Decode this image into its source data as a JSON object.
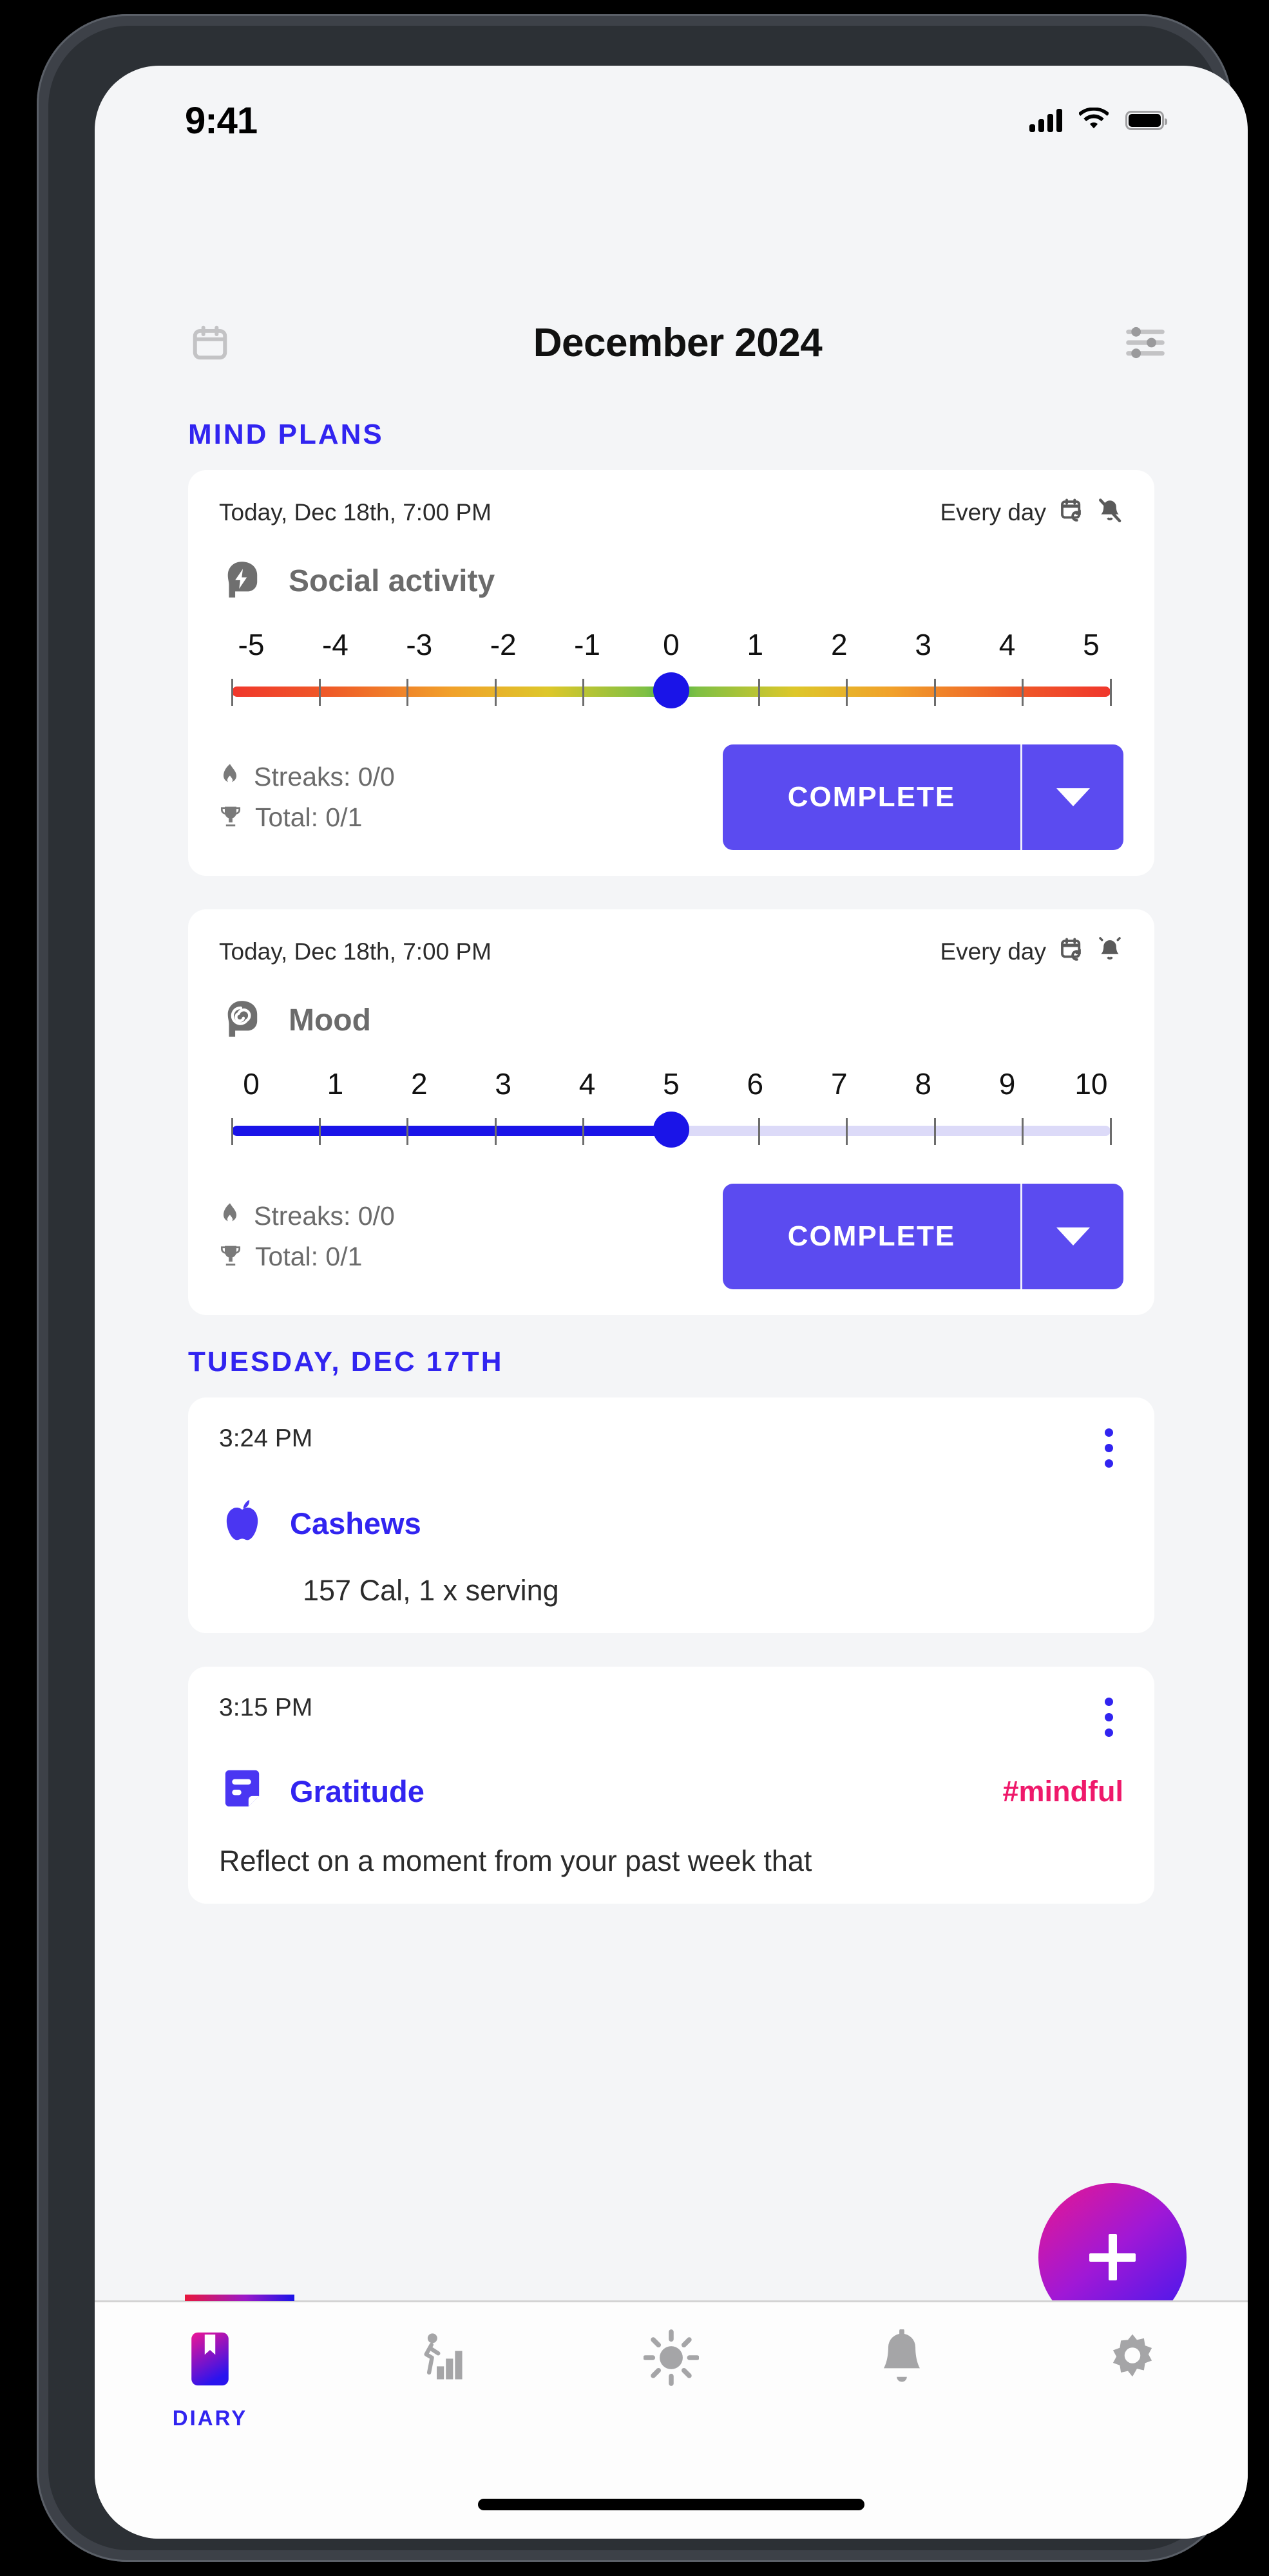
{
  "status_bar": {
    "time": "9:41",
    "cellular_icon": "cellular-signal-icon",
    "wifi_icon": "wifi-icon",
    "battery_icon": "battery-icon"
  },
  "header": {
    "calendar_icon": "calendar-icon",
    "title": "December 2024",
    "filter_icon": "filter-sliders-icon"
  },
  "sections": {
    "mind_plans_title": "MIND PLANS",
    "tuesday_title": "TUESDAY, DEC 17TH"
  },
  "plans": [
    {
      "date": "Today, Dec 18th, 7:00 PM",
      "schedule": "Every day",
      "repeat_icon": "calendar-repeat-icon",
      "notification_icon": "bell-off-icon",
      "icon": "head-lightning-icon",
      "title": "Social activity",
      "slider": {
        "labels": [
          "-5",
          "-4",
          "-3",
          "-2",
          "-1",
          "0",
          "1",
          "2",
          "3",
          "4",
          "5"
        ],
        "min": -5,
        "max": 5,
        "value": 0,
        "track_style": "rainbow"
      },
      "streaks_icon": "flame-icon",
      "streaks_label": "Streaks: 0/0",
      "total_icon": "trophy-icon",
      "total_label": "Total: 0/1",
      "complete_label": "COMPLETE",
      "dropdown_icon": "chevron-down-icon"
    },
    {
      "date": "Today, Dec 18th, 7:00 PM",
      "schedule": "Every day",
      "repeat_icon": "calendar-repeat-icon",
      "notification_icon": "bell-on-icon",
      "icon": "head-spiral-icon",
      "title": "Mood",
      "slider": {
        "labels": [
          "0",
          "1",
          "2",
          "3",
          "4",
          "5",
          "6",
          "7",
          "8",
          "9",
          "10"
        ],
        "min": 0,
        "max": 10,
        "value": 5,
        "track_style": "blue-fill"
      },
      "streaks_icon": "flame-icon",
      "streaks_label": "Streaks: 0/0",
      "total_icon": "trophy-icon",
      "total_label": "Total: 0/1",
      "complete_label": "COMPLETE",
      "dropdown_icon": "chevron-down-icon"
    }
  ],
  "entries": [
    {
      "time": "3:24 PM",
      "menu_icon": "kebab-menu-icon",
      "icon": "apple-icon",
      "title": "Cashews",
      "tag": "",
      "subtitle": "157 Cal, 1 x serving",
      "body": ""
    },
    {
      "time": "3:15 PM",
      "menu_icon": "kebab-menu-icon",
      "icon": "note-icon",
      "title": "Gratitude",
      "tag": "#mindful",
      "subtitle": "",
      "body": "Reflect on a moment from your past week that"
    }
  ],
  "fab": {
    "icon": "plus-icon"
  },
  "bottom_nav": [
    {
      "icon": "bookmark-icon",
      "label": "DIARY",
      "active": true
    },
    {
      "icon": "activity-progress-icon",
      "label": "",
      "active": false
    },
    {
      "icon": "sun-brightness-icon",
      "label": "",
      "active": false
    },
    {
      "icon": "bell-icon",
      "label": "",
      "active": false
    },
    {
      "icon": "gear-icon",
      "label": "",
      "active": false
    }
  ],
  "colors": {
    "accent_blue": "#3124f0",
    "button_purple": "#5b4bf0",
    "tag_pink": "#ef196b",
    "screen_bg": "#f4f5f7"
  }
}
